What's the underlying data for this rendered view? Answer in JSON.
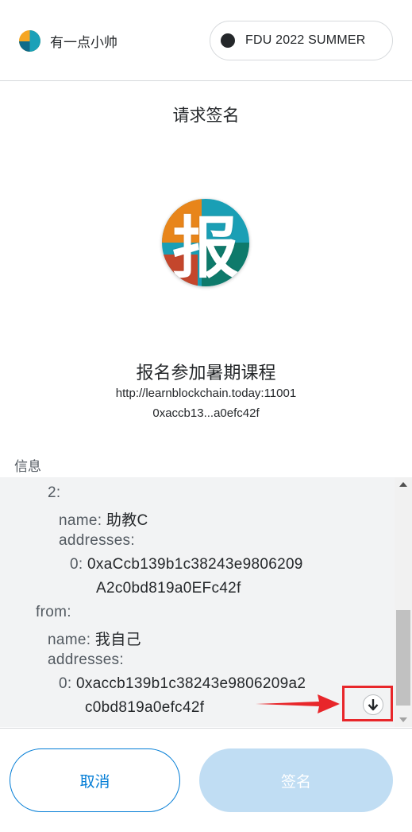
{
  "header": {
    "account_name": "有一点小帅",
    "network_label": "FDU 2022 SUMMER"
  },
  "title": "请求签名",
  "site": {
    "icon_char": "报",
    "name": "报名参加暑期课程",
    "origin": "http://learnblockchain.today:11001",
    "address": "0xaccb13...a0efc42f"
  },
  "message": {
    "label": "信息",
    "lines": [
      {
        "key": "2:",
        "value": ""
      },
      {
        "key": "name:",
        "value": "助教C"
      },
      {
        "key": "addresses:",
        "value": ""
      },
      {
        "key": "0:",
        "value": "0xaCcb139b1c38243e9806209"
      },
      {
        "key": "",
        "value": "A2c0bd819a0EFc42f"
      },
      {
        "key": "from:",
        "value": ""
      },
      {
        "key": "name:",
        "value": "我自己"
      },
      {
        "key": "addresses:",
        "value": ""
      },
      {
        "key": "0:",
        "value": "0xaccb139b1c38243e9806209a2"
      },
      {
        "key": "",
        "value": "c0bd819a0efc42f"
      }
    ]
  },
  "buttons": {
    "cancel": "取消",
    "sign": "签名"
  },
  "icons": {
    "scroll_down": "arrow-down-icon",
    "annotation": "red-arrow-icon"
  },
  "colors": {
    "primary": "#037dd6",
    "sign_disabled": "#c0ddf3",
    "annotation": "#e8262a"
  }
}
